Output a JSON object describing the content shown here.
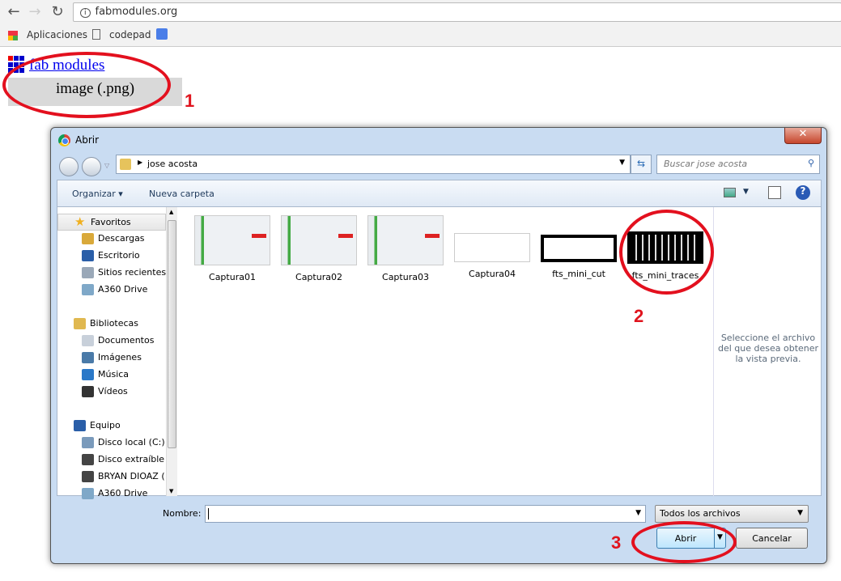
{
  "browser": {
    "url": "fabmodules.org",
    "bookmarks": [
      "Aplicaciones",
      "codepad"
    ]
  },
  "page": {
    "link": "fab modules",
    "button": "image (.png)"
  },
  "annotations": [
    "1",
    "2",
    "3"
  ],
  "dialog": {
    "title": "Abrir",
    "breadcrumb": "jose acosta",
    "search_placeholder": "Buscar jose acosta",
    "toolbar": {
      "organize": "Organizar ▾",
      "new_folder": "Nueva carpeta"
    },
    "sidebar": [
      {
        "label": "Favoritos",
        "header": true,
        "icon": "star-icon",
        "color": "#f0b020"
      },
      {
        "label": "Descargas",
        "icon": "downloads-icon",
        "color": "#d9a93a"
      },
      {
        "label": "Escritorio",
        "icon": "desktop-icon",
        "color": "#2a5ea8"
      },
      {
        "label": "Sitios recientes",
        "icon": "recent-places-icon",
        "color": "#9aa8b8"
      },
      {
        "label": "A360 Drive",
        "icon": "cloud-drive-icon",
        "color": "#7fa8c8"
      },
      {
        "label": "Bibliotecas",
        "header": true,
        "icon": "libraries-icon",
        "color": "#e0b850"
      },
      {
        "label": "Documentos",
        "icon": "documents-icon",
        "color": "#c8d0da"
      },
      {
        "label": "Imágenes",
        "icon": "pictures-icon",
        "color": "#4a7aa8"
      },
      {
        "label": "Música",
        "icon": "music-icon",
        "color": "#2a78c8"
      },
      {
        "label": "Vídeos",
        "icon": "videos-icon",
        "color": "#333"
      },
      {
        "label": "Equipo",
        "header": true,
        "icon": "computer-icon",
        "color": "#2a5ea8"
      },
      {
        "label": "Disco local (C:)",
        "icon": "local-disk-icon",
        "color": "#7a9abb"
      },
      {
        "label": "Disco extraíble (",
        "icon": "removable-disk-icon",
        "color": "#444"
      },
      {
        "label": "BRYAN DIOAZ (",
        "icon": "removable-disk-icon",
        "color": "#444"
      },
      {
        "label": "A360 Drive",
        "icon": "cloud-drive-icon",
        "color": "#7fa8c8"
      }
    ],
    "files": [
      {
        "name": "Captura01",
        "kind": "screenshot"
      },
      {
        "name": "Captura02",
        "kind": "screenshot"
      },
      {
        "name": "Captura03",
        "kind": "screenshot"
      },
      {
        "name": "Captura04",
        "kind": "screenshot-light"
      },
      {
        "name": "fts_mini_cut",
        "kind": "cut"
      },
      {
        "name": "fts_mini_traces",
        "kind": "traces"
      }
    ],
    "preview_text": "Seleccione el archivo del que desea obtener la vista previa.",
    "filename_label": "Nombre:",
    "filename_value": "",
    "filter": "Todos los archivos",
    "open": "Abrir",
    "cancel": "Cancelar"
  }
}
